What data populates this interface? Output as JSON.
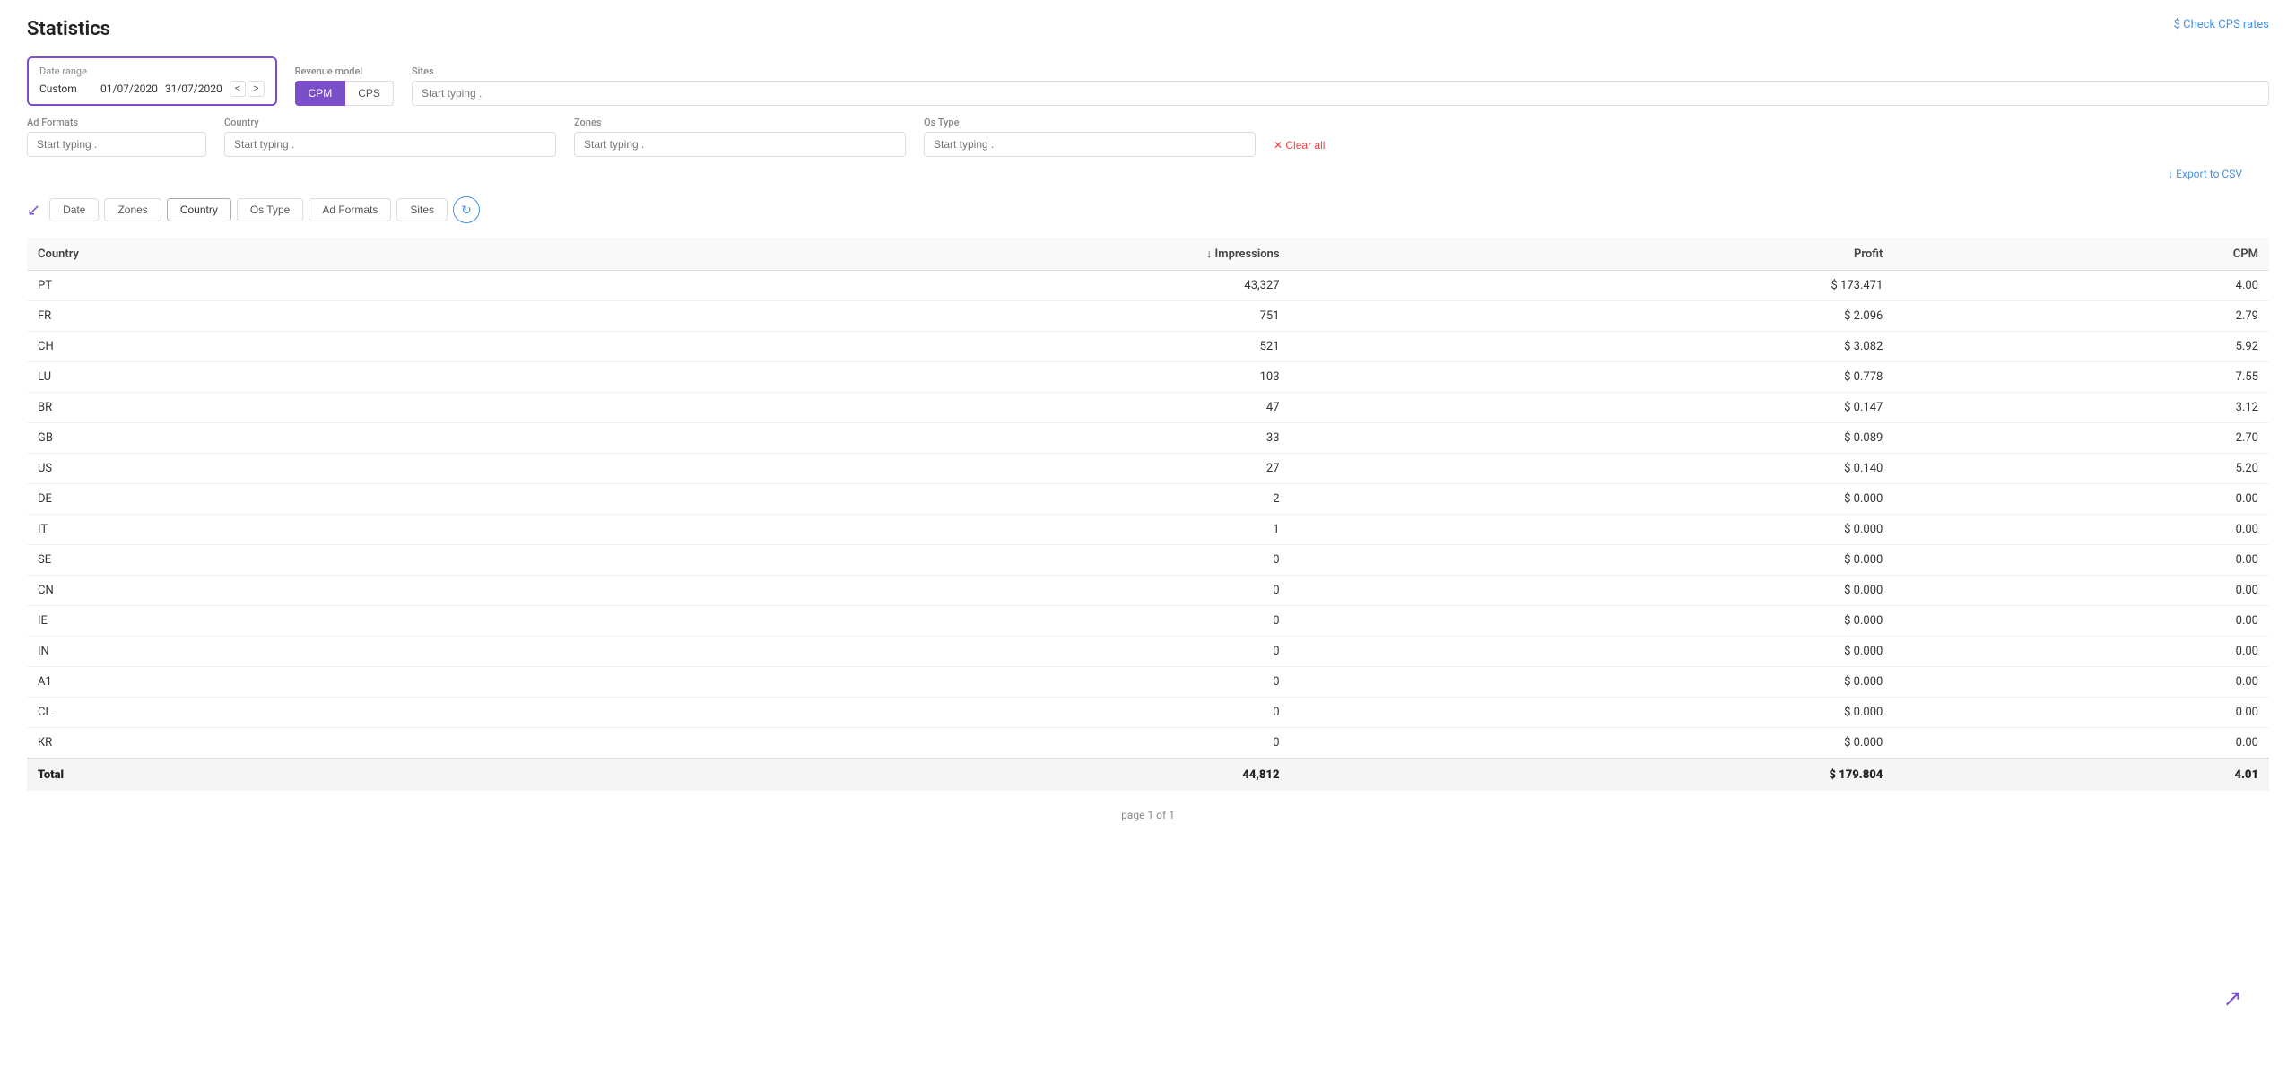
{
  "page": {
    "title": "Statistics",
    "check_cps_label": "$ Check CPS rates",
    "export_label": "↓ Export to CSV",
    "page_info": "page 1 of 1"
  },
  "filters": {
    "date_range_label": "Date range",
    "date_preset": "Custom",
    "date_from": "01/07/2020",
    "date_to": "31/07/2020",
    "revenue_model_label": "Revenue model",
    "cpm_label": "CPM",
    "cps_label": "CPS",
    "sites_label": "Sites",
    "sites_placeholder": "Start typing .",
    "ad_formats_label": "Ad Formats",
    "ad_formats_placeholder": "Start typing .",
    "country_label": "Country",
    "country_placeholder": "Start typing .",
    "zones_label": "Zones",
    "zones_placeholder": "Start typing .",
    "os_type_label": "Os Type",
    "os_type_placeholder": "Start typing .",
    "clear_all_label": "✕ Clear all"
  },
  "group_by": {
    "tabs": [
      {
        "label": "Date",
        "active": false
      },
      {
        "label": "Zones",
        "active": false
      },
      {
        "label": "Country",
        "active": true
      },
      {
        "label": "Os Type",
        "active": false
      },
      {
        "label": "Ad Formats",
        "active": false
      },
      {
        "label": "Sites",
        "active": false
      }
    ]
  },
  "table": {
    "columns": [
      {
        "key": "country",
        "label": "Country",
        "align": "left"
      },
      {
        "key": "impressions",
        "label": "↓ Impressions",
        "align": "right"
      },
      {
        "key": "profit",
        "label": "Profit",
        "align": "right"
      },
      {
        "key": "cpm",
        "label": "CPM",
        "align": "right"
      }
    ],
    "rows": [
      {
        "country": "PT",
        "impressions": "43,327",
        "profit": "$ 173.471",
        "cpm": "4.00"
      },
      {
        "country": "FR",
        "impressions": "751",
        "profit": "$ 2.096",
        "cpm": "2.79"
      },
      {
        "country": "CH",
        "impressions": "521",
        "profit": "$ 3.082",
        "cpm": "5.92"
      },
      {
        "country": "LU",
        "impressions": "103",
        "profit": "$ 0.778",
        "cpm": "7.55"
      },
      {
        "country": "BR",
        "impressions": "47",
        "profit": "$ 0.147",
        "cpm": "3.12"
      },
      {
        "country": "GB",
        "impressions": "33",
        "profit": "$ 0.089",
        "cpm": "2.70"
      },
      {
        "country": "US",
        "impressions": "27",
        "profit": "$ 0.140",
        "cpm": "5.20"
      },
      {
        "country": "DE",
        "impressions": "2",
        "profit": "$ 0.000",
        "cpm": "0.00"
      },
      {
        "country": "IT",
        "impressions": "1",
        "profit": "$ 0.000",
        "cpm": "0.00"
      },
      {
        "country": "SE",
        "impressions": "0",
        "profit": "$ 0.000",
        "cpm": "0.00"
      },
      {
        "country": "CN",
        "impressions": "0",
        "profit": "$ 0.000",
        "cpm": "0.00"
      },
      {
        "country": "IE",
        "impressions": "0",
        "profit": "$ 0.000",
        "cpm": "0.00"
      },
      {
        "country": "IN",
        "impressions": "0",
        "profit": "$ 0.000",
        "cpm": "0.00"
      },
      {
        "country": "A1",
        "impressions": "0",
        "profit": "$ 0.000",
        "cpm": "0.00"
      },
      {
        "country": "CL",
        "impressions": "0",
        "profit": "$ 0.000",
        "cpm": "0.00"
      },
      {
        "country": "KR",
        "impressions": "0",
        "profit": "$ 0.000",
        "cpm": "0.00"
      }
    ],
    "totals": {
      "label": "Total",
      "impressions": "44,812",
      "profit": "$ 179.804",
      "cpm": "4.01"
    }
  }
}
